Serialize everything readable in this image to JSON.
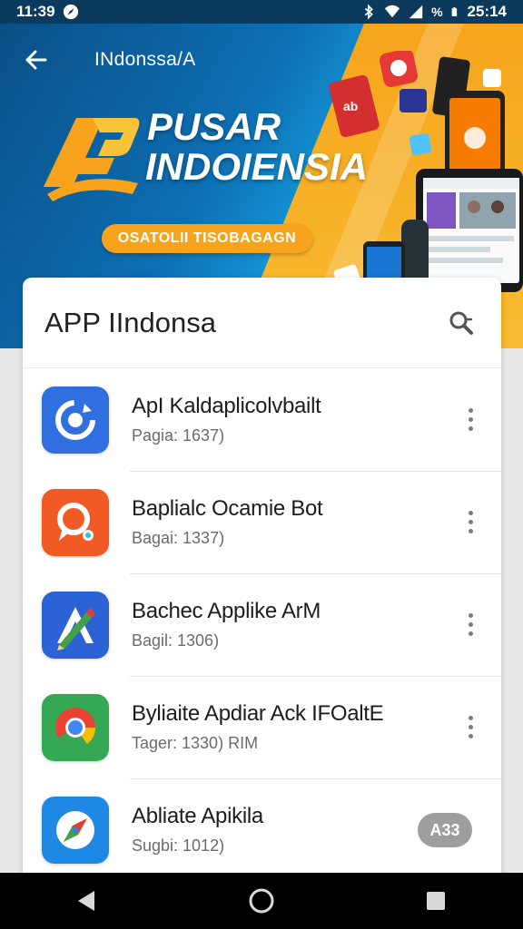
{
  "status_bar": {
    "time_left": "11:39",
    "battery_text": "%",
    "time_right": "25:14",
    "icons": [
      "compass-icon",
      "bluetooth-icon",
      "wifi-icon",
      "signal-icon",
      "battery-icon"
    ]
  },
  "header": {
    "back_icon": "arrow-left-icon",
    "title": "INdonssa/A"
  },
  "hero": {
    "title_line1": "PUSAR",
    "title_line2": "INDOIENSIA",
    "tagline": "OSATOLII TISOBAGAGN",
    "colors": {
      "blue": "#0d6fb3",
      "orange": "#f7a41c"
    }
  },
  "card": {
    "title": "APP IIndonsa",
    "search_icon": "search-icon"
  },
  "apps": [
    {
      "name": "ApI Kaldaplicolvbailt",
      "meta": "Pagia: 1637)",
      "icon": "refresh-app-icon",
      "color": "#2f6fe0",
      "action": "more"
    },
    {
      "name": "Baplialc Ocamie Bot",
      "meta": "Bagai: 1337)",
      "icon": "chat-bubble-app-icon",
      "color": "#f15a24",
      "action": "more"
    },
    {
      "name": "Bachec Applike ArM",
      "meta": "Bagil: 1306)",
      "icon": "pencil-app-icon",
      "color": "#2b63d6",
      "action": "more"
    },
    {
      "name": "Byliaite Apdiar Ack IFOaltE",
      "meta": "Tager: 1330) RIM",
      "icon": "chrome-app-icon",
      "color": "#34a853",
      "action": "more"
    },
    {
      "name": "Abliate Apikila",
      "meta": "Sugbi: 1012)",
      "icon": "compass-app-icon",
      "color": "#1e88e5",
      "action": "badge",
      "badge": "A33"
    }
  ],
  "nav": {
    "back": "triangle-back-icon",
    "home": "circle-home-icon",
    "recents": "square-recents-icon"
  }
}
